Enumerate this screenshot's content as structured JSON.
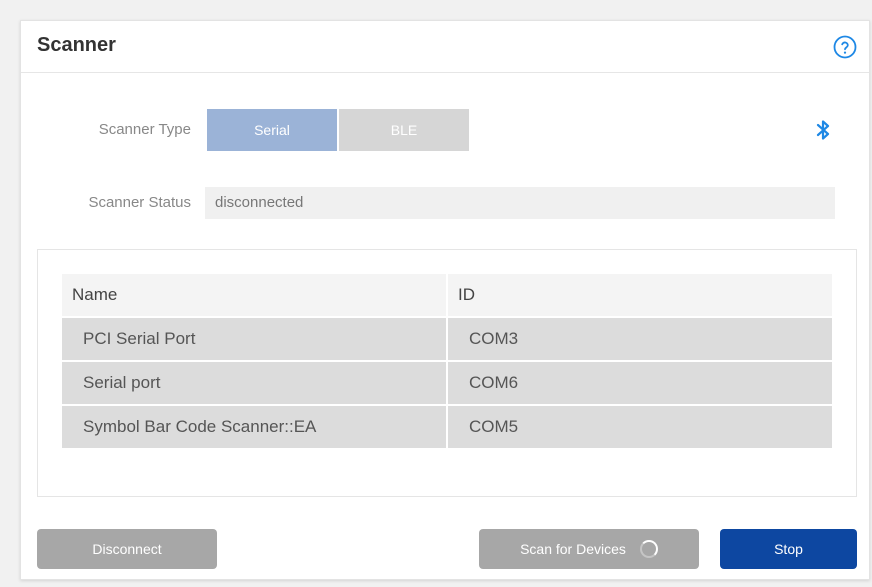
{
  "panel": {
    "title": "Scanner"
  },
  "scanner_type": {
    "label": "Scanner Type",
    "options": [
      "Serial",
      "BLE"
    ],
    "selected": "Serial"
  },
  "scanner_status": {
    "label": "Scanner Status",
    "value": "disconnected"
  },
  "devices_table": {
    "columns": [
      "Name",
      "ID"
    ],
    "rows": [
      {
        "name": "PCI Serial Port",
        "id": "COM3"
      },
      {
        "name": "Serial port",
        "id": "COM6"
      },
      {
        "name": "Symbol Bar Code Scanner::EA",
        "id": "COM5"
      }
    ]
  },
  "buttons": {
    "disconnect": "Disconnect",
    "scan": "Scan for Devices",
    "stop": "Stop"
  },
  "icons": {
    "help": "help-icon",
    "bluetooth": "bluetooth-icon",
    "spinner": "loading-spinner-icon"
  },
  "colors": {
    "selected_segment": "#9bb3d7",
    "unselected_segment": "#d6d6d6",
    "primary_button": "#0d47a1",
    "disabled_button": "#a7a7a7",
    "accent_icon": "#1e88e5"
  }
}
